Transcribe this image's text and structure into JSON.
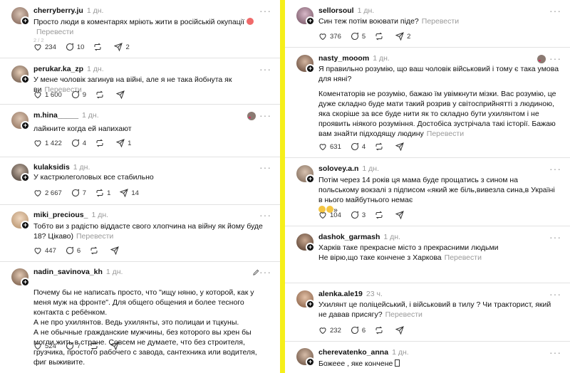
{
  "left_posts": [
    {
      "username": "cherryberry.ju",
      "time": "1 дн.",
      "text": "Просто люди в коментарях мріють жити в російській окупації",
      "translate": "Перевести",
      "pager": "2 / 2",
      "likes": "234",
      "comments": "10",
      "reposts": "",
      "shares": "2"
    },
    {
      "username": "perukar.ka_zp",
      "time": "1 дн.",
      "text": "У мене чоловік загинув на війні, але я не така йобнута як ви",
      "translate": "Перевести",
      "likes": "1 600",
      "comments": "9",
      "reposts": "",
      "shares": ""
    },
    {
      "username": "m.hina_____",
      "time": "1 дн.",
      "text": "лайкните когда ей напихают",
      "translate": "",
      "likes": "1 422",
      "comments": "4",
      "reposts": "",
      "shares": "1"
    },
    {
      "username": "kulaksidis",
      "time": "1 дн.",
      "text": "У кастрюлеголовых все стабильно",
      "translate": "",
      "likes": "2 667",
      "comments": "7",
      "reposts": "1",
      "shares": "14"
    },
    {
      "username": "miki_precious_",
      "time": "1 дн.",
      "text": "Тобто ви з радістю віддасте свого хлопчина на війну як йому буде 18? Цікаво)",
      "translate": "Перевести",
      "likes": "447",
      "comments": "6",
      "reposts": "",
      "shares": ""
    },
    {
      "username": "nadin_savinova_kh",
      "time": "1 дн.",
      "text": "Почему бы не написать просто, что \"ищу няню, у которой, как у меня муж на фронте\". Для общего общения и более тесного контакта с ребёнком.\nА не про ухилянтов. Ведь ухилянты, это полицаи и тцкуны.\nА не обычные гражданские мужчины, без которого вы хрен бы могли жить в стране. Совсем не думаете, что без строителя, грузчика, простого рабочего с завода, сантехника или водителя, фиг выживите.",
      "translate": "",
      "likes": "524",
      "comments": "7",
      "reposts": "",
      "shares": ""
    }
  ],
  "right_posts": [
    {
      "username": "sellorsoul",
      "time": "1 дн.",
      "text": "Син теж потім воювати піде?",
      "translate": "Перевести",
      "likes": "376",
      "comments": "5",
      "reposts": "",
      "shares": "2"
    },
    {
      "username": "nasty_mooom",
      "time": "1 дн.",
      "text": "Я правильно розумію, що ваш чоловік військовий і тому є така умова для няні?",
      "text2": "Коментаторів не розумію, бажаю їм увімкнути мізки. Вас розумію, це дуже складно буде мати такий розрив у світосприйнятті з людиною, яка скоріше за все буде нити як то складно бути ухилянтом і не проявить ніякого розуміння. Достобіса зустрічала такі історії. Бажаю вам знайти підходящу людину",
      "translate": "Перевести",
      "likes": "631",
      "comments": "4",
      "reposts": "",
      "shares": ""
    },
    {
      "username": "solovey.a.n",
      "time": "1 дн.",
      "text": "Потім через 14 років ця мама буде прощатись з сином на польському вокзалі з підписом «який же біль,вивезла сина,в Україні в нього майбутнього немає",
      "text_end": "»",
      "translate": "",
      "likes": "104",
      "comments": "3",
      "reposts": "",
      "shares": ""
    },
    {
      "username": "dashok_garmash",
      "time": "1 дн.",
      "text": "Харків таке прекрасне місто з прекрасними людьми",
      "text2": "Не вірю,що таке кончене з Харкова",
      "translate": "Перевести",
      "likes": "",
      "comments": "",
      "reposts": "",
      "shares": ""
    },
    {
      "username": "alenka.ale19",
      "time": "23 ч.",
      "text": "Ухилянт це поліцейський, і військовий в тилу ? Чи тракторист, який не давав присягу?",
      "translate": "Перевести",
      "likes": "232",
      "comments": "6",
      "reposts": "",
      "shares": ""
    },
    {
      "username": "cherevatenko_anna",
      "time": "1 дн.",
      "text": "Божеее , яке кончене ",
      "translate": "",
      "likes": "",
      "comments": "",
      "reposts": "",
      "shares": ""
    }
  ],
  "colors": {
    "divider": "#f6ef1a",
    "muted": "#999999",
    "border": "#e2e2e2"
  }
}
